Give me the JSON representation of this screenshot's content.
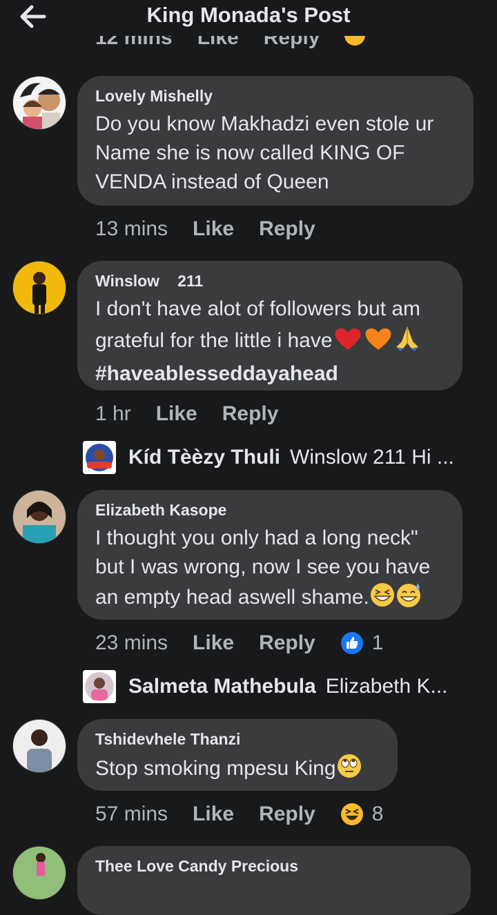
{
  "header": {
    "title": "King Monada's Post"
  },
  "comments": [
    {
      "name": "Lovely Mishelly",
      "text": "Do you know  Makhadzi even stole ur Name she is now called KING OF VENDA instead  of Queen",
      "time": "13 mins",
      "like": "Like",
      "reply": "Reply"
    },
    {
      "name": "Winslow",
      "badge": "211",
      "text": "I don't have alot of followers but am grateful for the little i have",
      "hashtag": "#haveablesseddayahead",
      "time": "1 hr",
      "like": "Like",
      "reply": "Reply",
      "reply_preview": {
        "name": "Kíd Tèèzy Thuli",
        "text": "Winslow 211 Hi ..."
      }
    },
    {
      "name": "Elizabeth Kasope",
      "text": "I thought you only had a long neck\" but I was wrong, now I see you have an empty head aswell shame.",
      "time": "23 mins",
      "like": "Like",
      "reply": "Reply",
      "reaction_count": "1",
      "reply_preview": {
        "name": "Salmeta Mathebula",
        "text": "Elizabeth K..."
      }
    },
    {
      "name": "Tshidevhele Thanzi",
      "text": "Stop smoking mpesu King",
      "time": "57 mins",
      "like": "Like",
      "reply": "Reply",
      "reaction_count": "8"
    },
    {
      "name": "Thee Love Candy Precious"
    }
  ],
  "colors": {
    "background": "#18191a",
    "bubble": "#3a3b3c",
    "text": "#e4e6eb",
    "muted": "#b0b3b8",
    "like_blue": "#1877f2"
  }
}
